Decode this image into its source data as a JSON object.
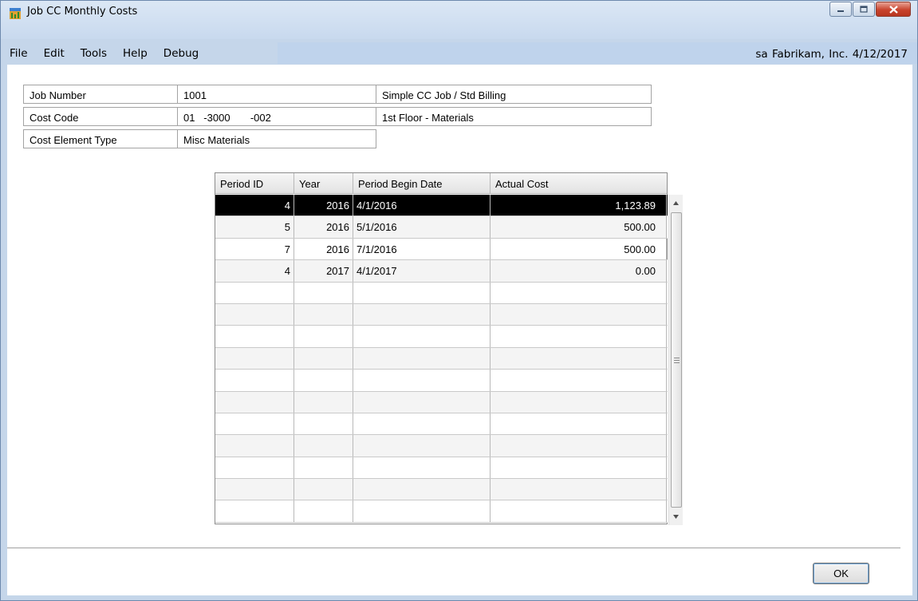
{
  "window": {
    "title": "Job CC Monthly Costs",
    "icon": "app-icon",
    "controls": {
      "minimize": "minimize-icon",
      "maximize": "maximize-icon",
      "close": "close-icon"
    }
  },
  "menu": [
    "File",
    "Edit",
    "Tools",
    "Help",
    "Debug"
  ],
  "user_info": "sa  Fabrikam, Inc.  4/12/2017",
  "fields": {
    "job_number": {
      "label": "Job Number",
      "value": "1001",
      "description": "Simple CC Job / Std Billing"
    },
    "cost_code": {
      "label": "Cost Code",
      "value": "01   -3000       -002",
      "description": "1st Floor - Materials"
    },
    "cost_element_type": {
      "label": "Cost Element Type",
      "value": "Misc Materials"
    }
  },
  "grid": {
    "columns": [
      "Period ID",
      "Year",
      "Period Begin Date",
      "Actual Cost"
    ],
    "rows": [
      {
        "period_id": "4",
        "year": "2016",
        "begin_date": "4/1/2016",
        "actual_cost": "1,123.89",
        "selected": true
      },
      {
        "period_id": "5",
        "year": "2016",
        "begin_date": "5/1/2016",
        "actual_cost": "500.00"
      },
      {
        "period_id": "7",
        "year": "2016",
        "begin_date": "7/1/2016",
        "actual_cost": "500.00"
      },
      {
        "period_id": "4",
        "year": "2017",
        "begin_date": "4/1/2017",
        "actual_cost": "0.00"
      }
    ],
    "empty_rows": 11
  },
  "buttons": {
    "ok": "OK"
  },
  "colors": {
    "window_frame": "#c5d6ea",
    "menu_strip": "#bfd3ec",
    "selected_row": "#000000",
    "close_button": "#c8432d"
  }
}
